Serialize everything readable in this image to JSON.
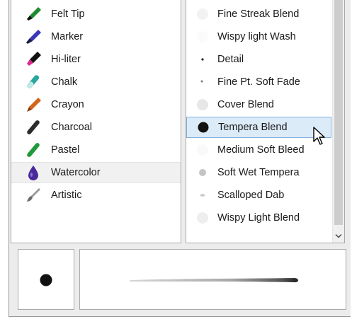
{
  "tools": [
    {
      "label": "Felt Tip",
      "icon": "felt-tip-icon",
      "color": "#1f8a2e"
    },
    {
      "label": "Marker",
      "icon": "marker-icon",
      "color": "#3b35b8"
    },
    {
      "label": "Hi-liter",
      "icon": "hi-liter-icon",
      "color": "#e0288f"
    },
    {
      "label": "Chalk",
      "icon": "chalk-icon",
      "color": "#2aa6a0"
    },
    {
      "label": "Crayon",
      "icon": "crayon-icon",
      "color": "#d4661c"
    },
    {
      "label": "Charcoal",
      "icon": "charcoal-icon",
      "color": "#2b2b2b"
    },
    {
      "label": "Pastel",
      "icon": "pastel-icon",
      "color": "#1f9a3a"
    },
    {
      "label": "Watercolor",
      "icon": "watercolor-icon",
      "color": "#4a2a9a",
      "selected": true
    },
    {
      "label": "Artistic",
      "icon": "artistic-icon",
      "color": "#8a8a8a"
    }
  ],
  "brushes": [
    {
      "label": "Fine Streak Blend",
      "icon": "fine-streak-blend-dot-icon"
    },
    {
      "label": "Wispy light Wash",
      "icon": "wispy-light-wash-dot-icon"
    },
    {
      "label": "Detail",
      "icon": "detail-dot-icon"
    },
    {
      "label": "Fine Pt. Soft Fade",
      "icon": "fine-pt-soft-fade-dot-icon"
    },
    {
      "label": "Cover Blend",
      "icon": "cover-blend-dot-icon"
    },
    {
      "label": "Tempera Blend",
      "icon": "tempera-blend-dot-icon",
      "selected": true
    },
    {
      "label": "Medium Soft Bleed",
      "icon": "medium-soft-bleed-dot-icon"
    },
    {
      "label": "Soft Wet Tempera",
      "icon": "soft-wet-tempera-dot-icon"
    },
    {
      "label": "Scalloped Dab",
      "icon": "scalloped-dab-dot-icon"
    },
    {
      "label": "Wispy Light Blend",
      "icon": "wispy-light-blend-dot-icon"
    }
  ],
  "scrollbar": {
    "down_icon": "chevron-down-icon"
  },
  "preview": {
    "dot_icon": "brush-dot-preview-icon",
    "stroke_icon": "brush-stroke-preview-icon"
  },
  "cursor_icon": "mouse-pointer-icon"
}
